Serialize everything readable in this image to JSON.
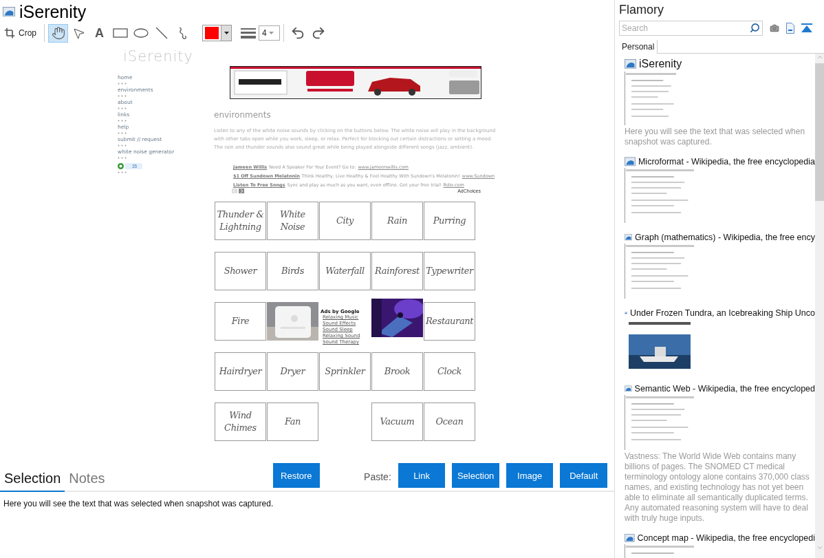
{
  "window": {
    "title": "iSerenity"
  },
  "toolbar": {
    "crop": {
      "label": "Crop"
    },
    "tools": [
      {
        "kind": "hand",
        "selected": true
      },
      {
        "kind": "pointer",
        "selected": false
      },
      {
        "kind": "text",
        "label": "A",
        "selected": false
      },
      {
        "kind": "rectangle",
        "selected": false
      },
      {
        "kind": "ellipse",
        "selected": false
      },
      {
        "kind": "line",
        "selected": false
      },
      {
        "kind": "freehand",
        "selected": false
      }
    ],
    "color_picker": {
      "color": "#ff0000"
    },
    "line_width": {
      "value": "4"
    }
  },
  "snapshot": {
    "site_logo": "iSerenity",
    "nav": [
      {
        "label": "home"
      },
      {
        "label": "environments"
      },
      {
        "label": "about"
      },
      {
        "label": "links"
      },
      {
        "label": "help"
      },
      {
        "label": "submit // request"
      },
      {
        "label": "white noise generator"
      }
    ],
    "share_count": "35",
    "ad_banner": {
      "kind": "picture"
    },
    "heading": "environments",
    "intro": "Listen to any of the white noise sounds by clicking on the buttons below. The white noise will play in the background with other tabs open while you work, sleep, or relax. Perfect for blocking out certain distractions or setting a mood. The rain and thunder sounds also sound great while being played alongside different songs (jazz, ambient).",
    "text_ads": [
      {
        "title": "Jameen Willis",
        "text": "Need A Speaker For Your Event? Go to:",
        "url": "www.jameenwillis.com"
      },
      {
        "title": "$1 Off Sundown Melatonin",
        "text": "Think Healthy, Live Healthy & Feel Healthy With Sundown's Melatonin!",
        "url": "www.Sundown"
      },
      {
        "title": "Listen To Free Songs",
        "text": "Sync and play as much as you want, even offline. Get your free trial!",
        "url": "Rdio.com"
      }
    ],
    "adchoices": "AdChoices",
    "grid": [
      {
        "kind": "sound",
        "label": "Thunder & Lightning"
      },
      {
        "kind": "sound",
        "label": "White Noise"
      },
      {
        "kind": "sound",
        "label": "City"
      },
      {
        "kind": "sound",
        "label": "Rain"
      },
      {
        "kind": "sound",
        "label": "Purring"
      },
      {
        "kind": "sound",
        "label": "Shower"
      },
      {
        "kind": "sound",
        "label": "Birds"
      },
      {
        "kind": "sound",
        "label": "Waterfall"
      },
      {
        "kind": "sound",
        "label": "Rainforest"
      },
      {
        "kind": "sound",
        "label": "Typewriter"
      },
      {
        "kind": "sound",
        "label": "Fire"
      },
      {
        "kind": "picture"
      },
      {
        "kind": "ads",
        "title": "Ads by Google",
        "links": [
          "Relaxing Music",
          "Sound Effects",
          "Sound Sleep",
          "Relaxing Sound",
          "Sound Therapy"
        ]
      },
      {
        "kind": "picture"
      },
      {
        "kind": "sound",
        "label": "Restaurant"
      },
      {
        "kind": "sound",
        "label": "Hairdryer"
      },
      {
        "kind": "sound",
        "label": "Dryer"
      },
      {
        "kind": "sound",
        "label": "Sprinkler"
      },
      {
        "kind": "sound",
        "label": "Brook"
      },
      {
        "kind": "sound",
        "label": "Clock"
      },
      {
        "kind": "sound",
        "label": "Wind Chimes"
      },
      {
        "kind": "sound",
        "label": "Fan"
      },
      {
        "kind": "empty"
      },
      {
        "kind": "sound",
        "label": "Vacuum"
      },
      {
        "kind": "sound",
        "label": "Ocean"
      }
    ]
  },
  "bottom": {
    "tabs": [
      {
        "label": "Selection",
        "selected": true
      },
      {
        "label": "Notes",
        "selected": false
      }
    ],
    "restore": "Restore",
    "paste_label": "Paste:",
    "paste_buttons": [
      "Link",
      "Selection",
      "Image",
      "Default"
    ],
    "selection_text": "Here you will see the text that was selected when snapshot was captured."
  },
  "sidebar": {
    "title": "Flamory",
    "search": {
      "placeholder": "Search"
    },
    "tabs": [
      {
        "label": "Personal",
        "selected": true
      }
    ],
    "snapshots": [
      {
        "title": "iSerenity",
        "selected": true,
        "note": "Here you will see the text that was selected when snapshot was captured."
      },
      {
        "title": "Microformat - Wikipedia, the free encyclopedia",
        "selected": false
      },
      {
        "title": "Graph (mathematics) - Wikipedia, the free ency",
        "selected": false
      },
      {
        "title": "Under Frozen Tundra, an Icebreaking Ship Unco",
        "selected": false
      },
      {
        "title": "Semantic Web - Wikipedia, the free encycloped",
        "selected": false,
        "note": "Vastness: The World Wide Web contains many billions of pages. The SNOMED CT medical terminology ontology alone contains 370,000 class names, and existing technology has not yet been able to eliminate all semantically duplicated terms. Any automated reasoning system will have to deal with truly huge inputs."
      },
      {
        "title": "Concept map - Wikipedia, the free encyclopedi",
        "selected": false
      }
    ]
  }
}
